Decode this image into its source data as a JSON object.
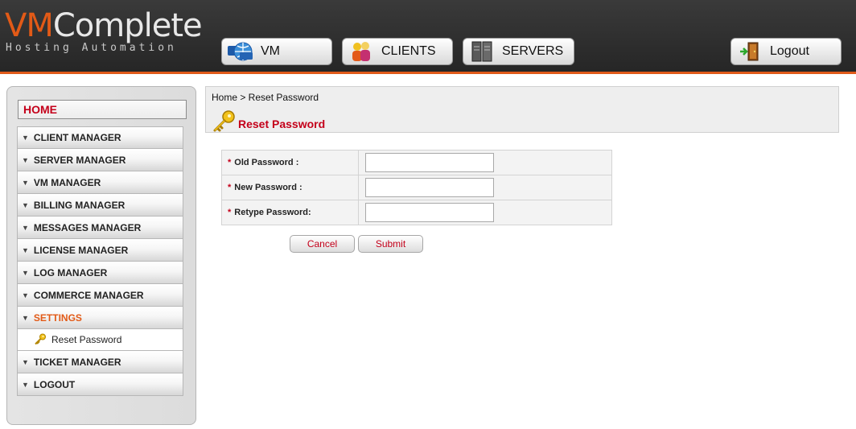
{
  "header": {
    "logo_vm": "VM",
    "logo_rest": "Complete",
    "tagline": "Hosting Automation",
    "nav": {
      "vm": "VM",
      "clients": "CLIENTS",
      "servers": "SERVERS",
      "logout": "Logout"
    }
  },
  "sidebar": {
    "home": "HOME",
    "items": [
      {
        "label": "CLIENT MANAGER"
      },
      {
        "label": "SERVER MANAGER"
      },
      {
        "label": "VM MANAGER"
      },
      {
        "label": "BILLING MANAGER"
      },
      {
        "label": "MESSAGES MANAGER"
      },
      {
        "label": "LICENSE MANAGER"
      },
      {
        "label": "LOG MANAGER"
      },
      {
        "label": "COMMERCE MANAGER"
      },
      {
        "label": "SETTINGS"
      },
      {
        "label": "TICKET MANAGER"
      },
      {
        "label": "LOGOUT"
      }
    ],
    "settings_sub": {
      "label": "Reset Password"
    }
  },
  "breadcrumb": "Home > Reset Password",
  "page_title": "Reset Password",
  "form": {
    "required_marker": "*",
    "fields": [
      {
        "label": "Old Password :",
        "value": ""
      },
      {
        "label": "New Password :",
        "value": ""
      },
      {
        "label": "Retype Password:",
        "value": ""
      }
    ],
    "cancel": "Cancel",
    "submit": "Submit"
  },
  "colors": {
    "accent_orange": "#e25a17",
    "title_red": "#c4001a",
    "header_bg": "#2e2e2e"
  }
}
